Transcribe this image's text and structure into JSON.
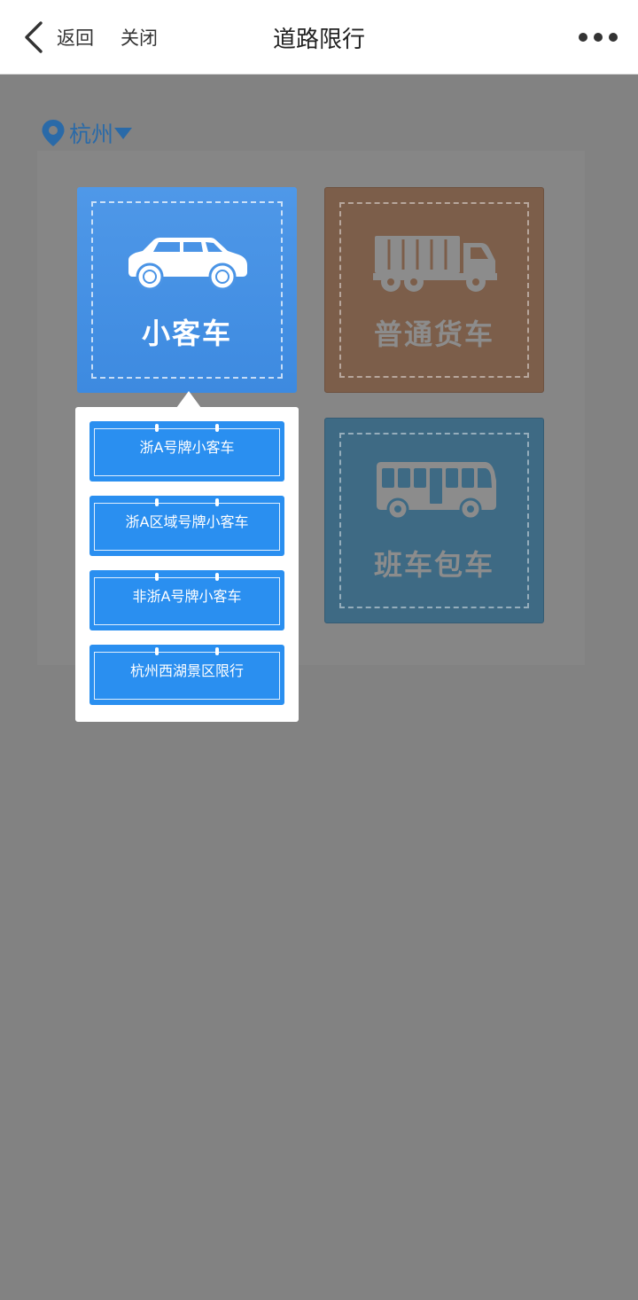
{
  "nav": {
    "back_label": "返回",
    "close_label": "关闭",
    "title": "道路限行"
  },
  "city": {
    "name": "杭州"
  },
  "tiles": [
    {
      "label": "小客车",
      "icon": "car-icon"
    },
    {
      "label": "普通货车",
      "icon": "truck-icon"
    },
    {
      "label": "班车包车",
      "icon": "bus-icon"
    }
  ],
  "popover": {
    "items": [
      {
        "label": "浙A号牌小客车"
      },
      {
        "label": "浙A区域号牌小客车"
      },
      {
        "label": "非浙A号牌小客车"
      },
      {
        "label": "杭州西湖景区限行"
      }
    ]
  },
  "colors": {
    "accent": "#2a8ff0",
    "car_tile": "#4a94e6",
    "truck_tile": "#7c5e4a",
    "bus_tile": "#3e6a84",
    "overlay": "#828282"
  }
}
